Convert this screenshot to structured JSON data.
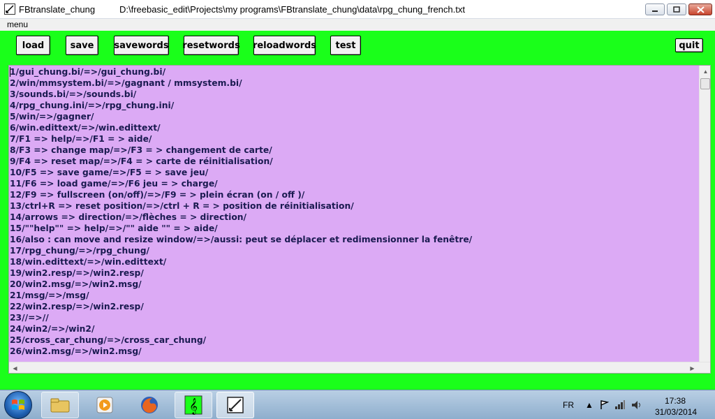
{
  "window": {
    "app_title": "FBtranslate_chung",
    "file_path": "D:\\freebasic_edit\\Projects\\my programs\\FBtranslate_chung\\data\\rpg_chung_french.txt"
  },
  "menu": {
    "label": "menu"
  },
  "toolbar": {
    "load": "load",
    "save": "save",
    "savewords": "savewords",
    "resetwords": "resetwords",
    "reloadwords": "reloadwords",
    "test": "test",
    "quit": "quit"
  },
  "editor": {
    "background": "#dcaaf5",
    "lines": [
      "1/gui_chung.bi/=>/gui_chung.bi/",
      "2/win/mmsystem.bi/=>/gagnant / mmsystem.bi/",
      "3/sounds.bi/=>/sounds.bi/",
      "4/rpg_chung.ini/=>/rpg_chung.ini/",
      "5/win/=>/gagner/",
      "6/win.edittext/=>/win.edittext/",
      "7/F1 => help/=>/F1 = > aide/",
      "8/F3 => change map/=>/F3 = > changement de carte/",
      "9/F4 => reset map/=>/F4 = > carte de réinitialisation/",
      "10/F5 => save game/=>/F5 = > save jeu/",
      "11/F6 => load game/=>/F6 jeu = > charge/",
      "12/F9 => fullscreen (on/off)/=>/F9 = > plein écran (on / off )/",
      "13/ctrl+R => reset position/=>/ctrl + R = > position de réinitialisation/",
      "14/arrows => direction/=>/flèches = > direction/",
      "15/\"\"help\"\" => help/=>/\"\" aide \"\" = > aide/",
      "16/also : can move and resize window/=>/aussi: peut se déplacer et redimensionner la fenêtre/",
      "17/rpg_chung/=>/rpg_chung/",
      "18/win.edittext/=>/win.edittext/",
      "19/win2.resp/=>/win2.resp/",
      "20/win2.msg/=>/win2.msg/",
      "21/msg/=>/msg/",
      "22/win2.resp/=>/win2.resp/",
      "23//=>//",
      "24/win2/=>/win2/",
      "25/cross_car_chung/=>/cross_car_chung/",
      "26/win2.msg/=>/win2.msg/"
    ]
  },
  "taskbar": {
    "language": "FR",
    "time": "17:38",
    "date": "31/03/2014"
  },
  "colors": {
    "window_bg": "#1aff1a",
    "editor_bg": "#dcaaf5",
    "text": "#1a1a50"
  }
}
